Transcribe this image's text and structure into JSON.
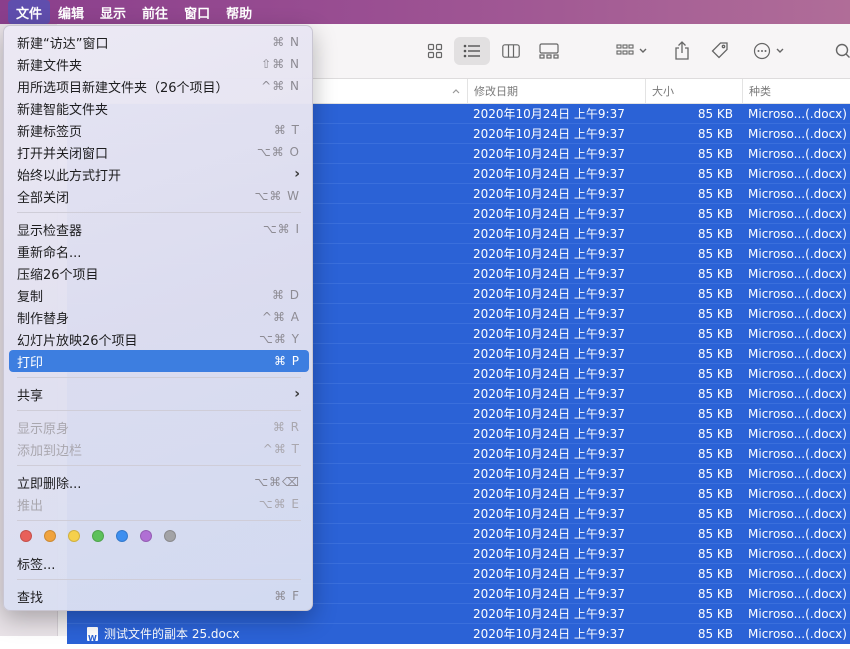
{
  "menubar": {
    "items": [
      "文件",
      "编辑",
      "显示",
      "前往",
      "窗口",
      "帮助"
    ]
  },
  "columns": {
    "date": "修改日期",
    "size": "大小",
    "kind": "种类"
  },
  "files": {
    "visible_name": "测试文件的副本 25.docx",
    "date": "2020年10月24日 上午9:37",
    "size": "85 KB",
    "kind": "Microso...(.docx)"
  },
  "menu": {
    "new_finder_window": {
      "label": "新建“访达”窗口",
      "shortcut": "⌘ N"
    },
    "new_folder": {
      "label": "新建文件夹",
      "shortcut": "⇧⌘ N"
    },
    "new_folder_with_selection": {
      "label": "用所选项目新建文件夹（26个项目）",
      "shortcut": "^⌘ N"
    },
    "new_smart_folder": {
      "label": "新建智能文件夹",
      "shortcut": ""
    },
    "new_tab": {
      "label": "新建标签页",
      "shortcut": "⌘ T"
    },
    "open_and_close": {
      "label": "打开并关闭窗口",
      "shortcut": "⌥⌘ O"
    },
    "always_open_with": {
      "label": "始终以此方式打开",
      "shortcut": ""
    },
    "close_all": {
      "label": "全部关闭",
      "shortcut": "⌥⌘ W"
    },
    "show_inspector": {
      "label": "显示检查器",
      "shortcut": "⌥⌘ I"
    },
    "rename": {
      "label": "重新命名...",
      "shortcut": ""
    },
    "compress": {
      "label": "压缩26个项目",
      "shortcut": ""
    },
    "duplicate": {
      "label": "复制",
      "shortcut": "⌘ D"
    },
    "make_alias": {
      "label": "制作替身",
      "shortcut": "^⌘ A"
    },
    "slideshow": {
      "label": "幻灯片放映26个项目",
      "shortcut": "⌥⌘ Y"
    },
    "print": {
      "label": "打印",
      "shortcut": "⌘ P"
    },
    "share": {
      "label": "共享",
      "shortcut": ""
    },
    "show_original": {
      "label": "显示原身",
      "shortcut": "⌘ R"
    },
    "add_to_sidebar": {
      "label": "添加到边栏",
      "shortcut": "^⌘ T"
    },
    "delete_immediately": {
      "label": "立即删除...",
      "shortcut": "⌥⌘⌫"
    },
    "eject": {
      "label": "推出",
      "shortcut": "⌥⌘ E"
    },
    "tags": {
      "label": "标签..."
    },
    "find": {
      "label": "查找",
      "shortcut": "⌘ F"
    }
  },
  "tag_colors": [
    "#e8605a",
    "#f0a33e",
    "#f5d04c",
    "#5dc15b",
    "#3d8ff0",
    "#b06fd4",
    "#a3a3a6"
  ]
}
